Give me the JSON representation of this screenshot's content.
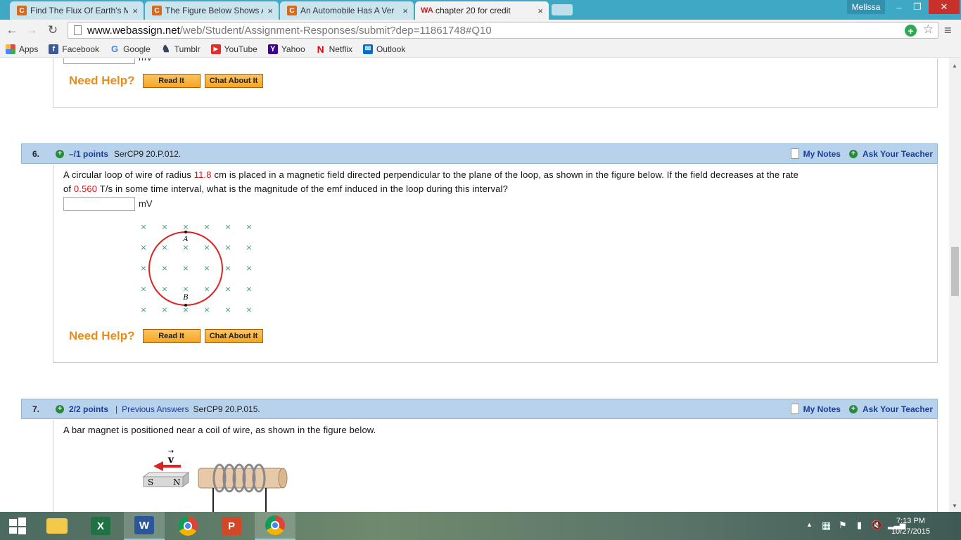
{
  "browser": {
    "tabs": [
      {
        "favicon": "C",
        "title": "Find The Flux Of Earth's M"
      },
      {
        "favicon": "C",
        "title": "The Figure Below Shows A"
      },
      {
        "favicon": "C",
        "title": "An Automobile Has A Ver"
      },
      {
        "favicon": "WA",
        "title": "chapter 20 for credit"
      }
    ],
    "user": "Melissa",
    "url_host": "www.webassign.net",
    "url_path": "/web/Student/Assignment-Responses/submit?dep=11861748#Q10",
    "bookmarks": [
      {
        "label": "Apps",
        "icon": "apps-grid-icon"
      },
      {
        "label": "Facebook",
        "icon": "facebook-icon"
      },
      {
        "label": "Google",
        "icon": "google-icon"
      },
      {
        "label": "Tumblr",
        "icon": "tumblr-icon"
      },
      {
        "label": "YouTube",
        "icon": "youtube-icon"
      },
      {
        "label": "Yahoo",
        "icon": "yahoo-icon"
      },
      {
        "label": "Netflix",
        "icon": "netflix-icon"
      },
      {
        "label": "Outlook",
        "icon": "outlook-icon"
      }
    ]
  },
  "prev_question": {
    "unit": "mV",
    "need_help": "Need Help?",
    "read_it": "Read It",
    "chat_about_it": "Chat About It"
  },
  "q6": {
    "number": "6.",
    "points": "–/1 points",
    "code": "SerCP9 20.P.012.",
    "my_notes": "My Notes",
    "ask_teacher": "Ask Your Teacher",
    "text_1": "A circular loop of wire of radius ",
    "radius": "11.8",
    "text_2": " cm is placed in a magnetic field directed perpendicular to the plane of the loop, as shown in the figure below. If the field decreases at the rate",
    "text_3": "of ",
    "rate": "0.560",
    "text_4": " T/s in some time interval, what is the magnitude of the emf induced in the loop during this interval?",
    "unit": "mV",
    "answer_value": "",
    "figure": {
      "label_a": "A",
      "label_b": "B",
      "field_symbol": "×"
    },
    "need_help": "Need Help?",
    "read_it": "Read It",
    "chat_about_it": "Chat About It"
  },
  "q7": {
    "number": "7.",
    "points": "2/2 points",
    "separator": "|",
    "previous_answers": "Previous Answers",
    "code": "SerCP9 20.P.015.",
    "my_notes": "My Notes",
    "ask_teacher": "Ask Your Teacher",
    "text": "A bar magnet is positioned near a coil of wire, as shown in the figure below.",
    "figure": {
      "velocity_label": "v",
      "south": "S",
      "north": "N"
    }
  },
  "taskbar": {
    "time": "7:13 PM",
    "date": "10/27/2015",
    "apps": [
      "start-icon",
      "file-explorer-icon",
      "excel-icon",
      "word-icon",
      "chrome-icon",
      "powerpoint-icon",
      "chrome-active-icon"
    ]
  }
}
